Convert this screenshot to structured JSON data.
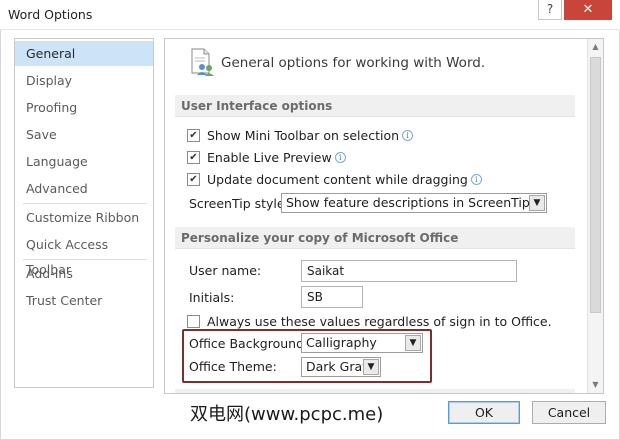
{
  "window": {
    "title": "Word Options",
    "help_glyph": "?",
    "close_glyph": "✕"
  },
  "sidebar": {
    "items": [
      {
        "label": "General",
        "active": true
      },
      {
        "label": "Display"
      },
      {
        "label": "Proofing"
      },
      {
        "label": "Save"
      },
      {
        "label": "Language"
      },
      {
        "label": "Advanced"
      },
      {
        "label": "Customize Ribbon"
      },
      {
        "label": "Quick Access Toolbar"
      },
      {
        "label": "Add-Ins"
      },
      {
        "label": "Trust Center"
      }
    ]
  },
  "main": {
    "header": "General options for working with Word.",
    "ui_section": {
      "title": "User Interface options",
      "checkboxes": [
        {
          "label": "Show Mini Toolbar on selection",
          "checked": true,
          "info": true
        },
        {
          "label": "Enable Live Preview",
          "checked": true,
          "info": true
        },
        {
          "label": "Update document content while dragging",
          "checked": true,
          "info": true
        }
      ],
      "screentip_label": "ScreenTip style:",
      "screentip_value": "Show feature descriptions in ScreenTips"
    },
    "personalize_section": {
      "title": "Personalize your copy of Microsoft Office",
      "username_label": "User name:",
      "username_value": "Saikat",
      "initials_label": "Initials:",
      "initials_value": "SB",
      "always_use_label": "Always use these values regardless of sign in to Office.",
      "always_use_checked": false,
      "background_label": "Office Background:",
      "background_value": "Calligraphy",
      "theme_label": "Office Theme:",
      "theme_value": "Dark Gray"
    }
  },
  "footer": {
    "watermark": "双电网(www.pcpc.me)",
    "ok_label": "OK",
    "cancel_label": "Cancel"
  },
  "colors": {
    "active_nav": "#cde3f7",
    "close_button": "#c7453a",
    "highlight_border": "#7b2f2f"
  }
}
